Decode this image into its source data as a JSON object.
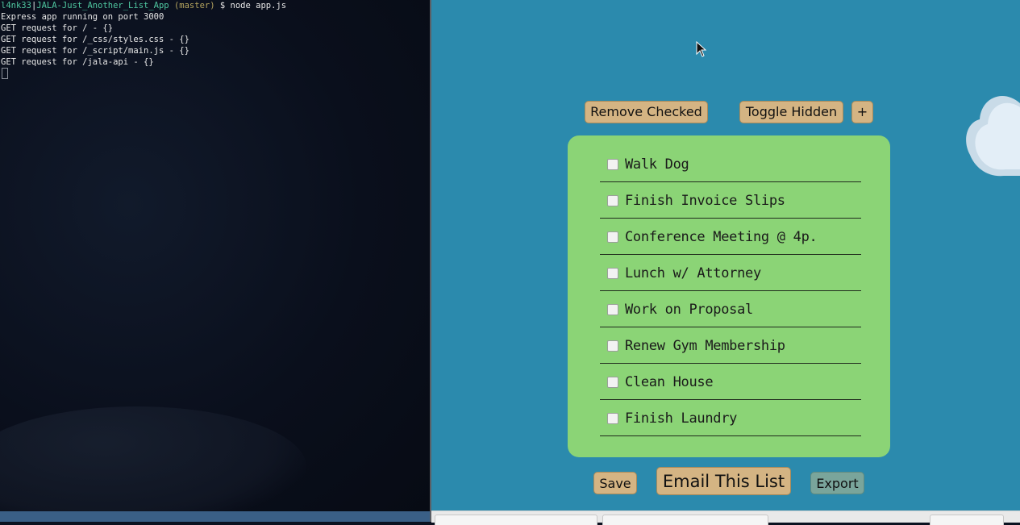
{
  "terminal": {
    "prompt_user": "l4nk33",
    "prompt_sep": "|",
    "prompt_path": "JALA-Just_Another_List_App",
    "prompt_branch": "(master)",
    "prompt_dollar": "$",
    "prompt_command": "node app.js",
    "output_lines": [
      "Express app running on port 3000",
      "GET request for / - {}",
      "GET request for /_css/styles.css - {}",
      "GET request for /_script/main.js - {}",
      "GET request for /jala-api - {}"
    ]
  },
  "app": {
    "toolbar": {
      "remove_checked_label": "Remove Checked",
      "toggle_hidden_label": "Toggle Hidden",
      "add_label": "+"
    },
    "items": [
      {
        "label": "Walk Dog",
        "checked": false
      },
      {
        "label": "Finish Invoice Slips",
        "checked": false
      },
      {
        "label": "Conference Meeting @ 4p.",
        "checked": false
      },
      {
        "label": "Lunch w/ Attorney",
        "checked": false
      },
      {
        "label": "Work on Proposal",
        "checked": false
      },
      {
        "label": "Renew Gym Membership",
        "checked": false
      },
      {
        "label": "Clean House",
        "checked": false
      },
      {
        "label": "Finish Laundry",
        "checked": false
      }
    ],
    "footer": {
      "save_label": "Save",
      "email_label": "Email This List",
      "export_label": "Export"
    }
  },
  "colors": {
    "background": "#2b8aad",
    "card": "#8bd476",
    "button": "#d4b483",
    "export_button": "#7aa59b"
  },
  "icons": [
    "cloud-icon",
    "mouse-pointer-icon",
    "checkbox-icon"
  ]
}
